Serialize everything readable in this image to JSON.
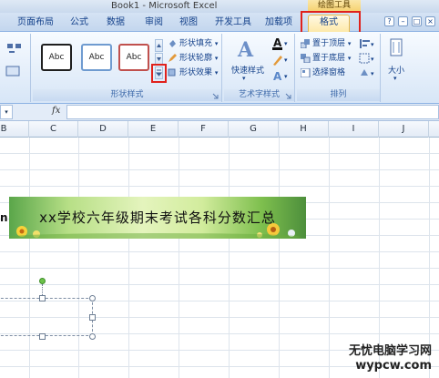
{
  "titlebar": {
    "title": "Book1 - Microsoft Excel",
    "context_tools": "绘图工具"
  },
  "tabs": [
    {
      "label": "页面布局"
    },
    {
      "label": "公式"
    },
    {
      "label": "数据"
    },
    {
      "label": "审阅"
    },
    {
      "label": "视图"
    },
    {
      "label": "开发工具"
    },
    {
      "label": "加载项"
    },
    {
      "label": "格式"
    }
  ],
  "ribbon": {
    "shape_styles": {
      "samples": [
        "Abc",
        "Abc",
        "Abc"
      ],
      "fill": "形状填充",
      "outline": "形状轮廓",
      "effects": "形状效果",
      "label": "形状样式"
    },
    "wordart": {
      "quick_styles": "快速样式",
      "label": "艺术字样式"
    },
    "arrange": {
      "bring_front": "置于顶层",
      "send_back": "置于底层",
      "selection_pane": "选择窗格",
      "label": "排列"
    },
    "size": {
      "label": "大小"
    }
  },
  "formula_bar": {
    "fx": "fx",
    "value": ""
  },
  "columns": [
    "B",
    "C",
    "D",
    "E",
    "F",
    "G",
    "H",
    "I",
    "J"
  ],
  "sheet": {
    "banner_text": "xx学校六年级期末考试各科分数汇总",
    "row_fragment": "n"
  },
  "watermark": {
    "line1": "无忧电脑学习网",
    "line2": "wypcw.com"
  },
  "colors": {
    "accent_highlight": "#e0211c",
    "active_tab": "#fde9a9",
    "ribbon_text": "#15428b"
  }
}
